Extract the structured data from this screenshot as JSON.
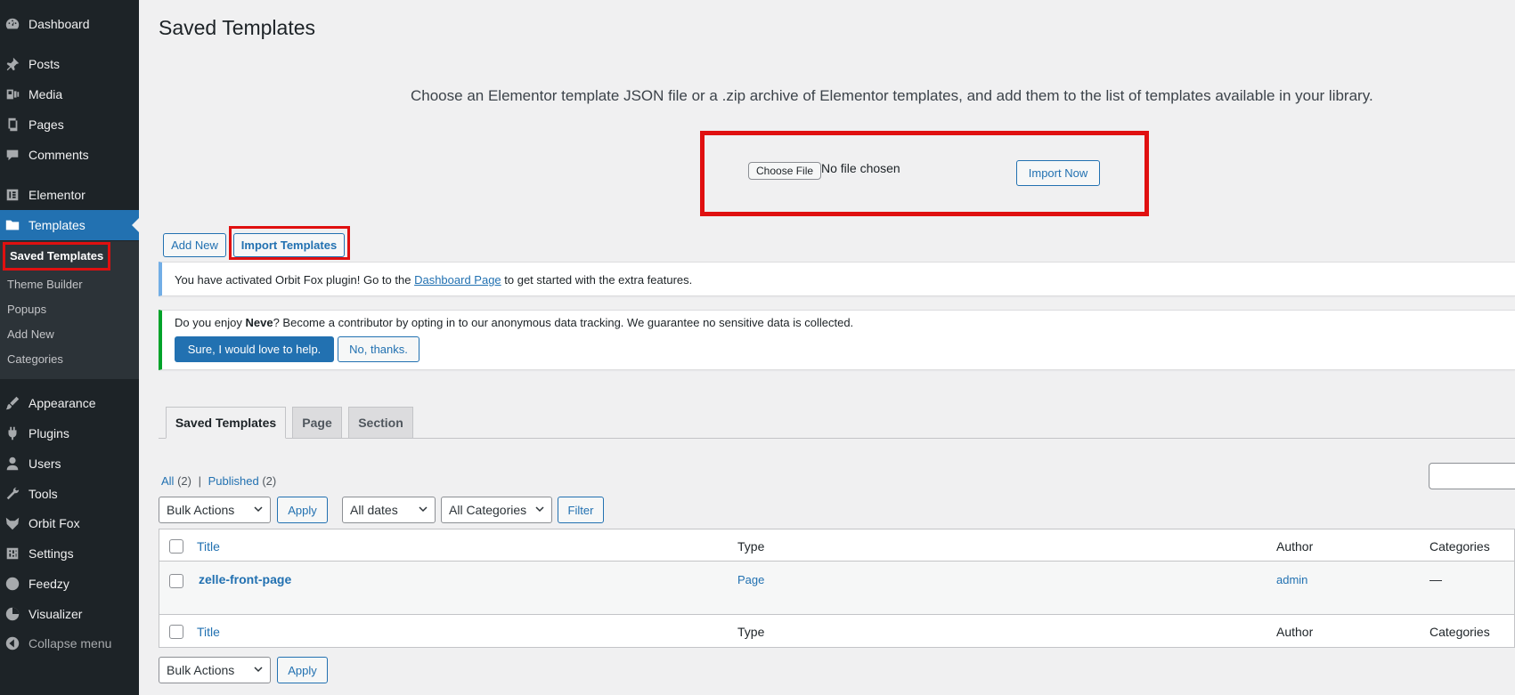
{
  "sidebar": {
    "items": [
      {
        "label": "Dashboard",
        "icon": "dashboard-icon"
      },
      {
        "label": "Posts",
        "icon": "pin-icon"
      },
      {
        "label": "Media",
        "icon": "media-icon"
      },
      {
        "label": "Pages",
        "icon": "pages-icon"
      },
      {
        "label": "Comments",
        "icon": "comment-icon"
      },
      {
        "label": "Elementor",
        "icon": "elementor-icon"
      },
      {
        "label": "Templates",
        "icon": "folder-icon"
      },
      {
        "label": "Appearance",
        "icon": "brush-icon"
      },
      {
        "label": "Plugins",
        "icon": "plug-icon"
      },
      {
        "label": "Users",
        "icon": "user-icon"
      },
      {
        "label": "Tools",
        "icon": "wrench-icon"
      },
      {
        "label": "Orbit Fox",
        "icon": "fox-icon"
      },
      {
        "label": "Settings",
        "icon": "settings-icon"
      },
      {
        "label": "Feedzy",
        "icon": "feed-icon"
      },
      {
        "label": "Visualizer",
        "icon": "chart-icon"
      }
    ],
    "collapse_label": "Collapse menu",
    "submenu": [
      "Saved Templates",
      "Theme Builder",
      "Popups",
      "Add New",
      "Categories"
    ]
  },
  "page": {
    "title": "Saved Templates",
    "import_description": "Choose an Elementor template JSON file or a .zip archive of Elementor templates, and add them to the list of templates available in your library.",
    "choose_file": "Choose File",
    "no_file": "No file chosen",
    "import_now": "Import Now",
    "add_new": "Add New",
    "import_templates": "Import Templates"
  },
  "notices": {
    "orbit_before": "You have activated Orbit Fox plugin! Go to the ",
    "orbit_link": "Dashboard Page",
    "orbit_after": " to get started with the extra features.",
    "neve_before": "Do you enjoy ",
    "neve_bold": "Neve",
    "neve_after": "? Become a contributor by opting in to our anonymous data tracking. We guarantee no sensitive data is collected.",
    "sure": "Sure, I would love to help.",
    "no_thanks": "No, thanks."
  },
  "tabs": [
    "Saved Templates",
    "Page",
    "Section"
  ],
  "filters": {
    "all": "All",
    "all_count": "(2)",
    "separator": "|",
    "published": "Published",
    "published_count": "(2)",
    "bulk_actions": "Bulk Actions",
    "apply": "Apply",
    "all_dates": "All dates",
    "all_categories": "All Categories",
    "filter": "Filter"
  },
  "table": {
    "columns": [
      "Title",
      "Type",
      "Author",
      "Categories"
    ],
    "rows": [
      {
        "title": "zelle-front-page",
        "type": "Page",
        "author": "admin",
        "categories": "—"
      }
    ]
  },
  "colors": {
    "sidebar_bg": "#1d2327",
    "accent": "#2271b1",
    "highlight": "#e01010"
  }
}
